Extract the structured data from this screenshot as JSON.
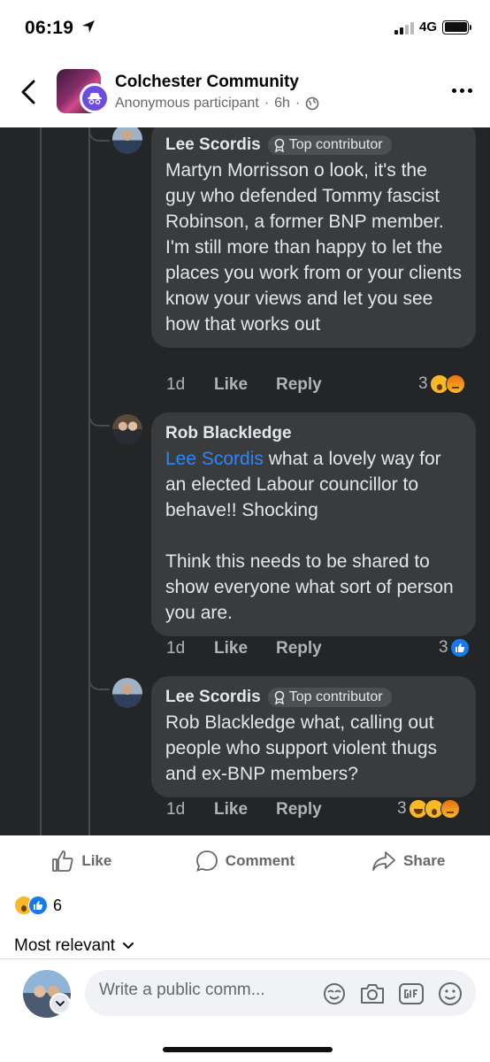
{
  "status_bar": {
    "time": "06:19",
    "network": "4G"
  },
  "header": {
    "group_name": "Colchester Community",
    "participant": "Anonymous participant",
    "age": "6h",
    "separator": "·"
  },
  "comments": [
    {
      "author": "Lee Scordis",
      "badge": "Top contributor",
      "mention": "",
      "text": "Martyn Morrisson o look, it's the guy who defended Tommy fascist Robinson, a former BNP member. I'm still more than happy to let the places you work from or your clients know your views and let you see how that works out",
      "time": "1d",
      "like": "Like",
      "reply": "Reply",
      "reactions": "3",
      "reaction_icons": [
        "wow-emoji-icon",
        "angry-emoji-icon"
      ]
    },
    {
      "author": "Rob Blackledge",
      "badge": "",
      "mention": "Lee Scordis",
      "text": " what a lovely way for an elected Labour councillor to behave!! Shocking\n\nThink this needs to be shared to show everyone what sort of person you are.",
      "time": "1d",
      "like": "Like",
      "reply": "Reply",
      "reactions": "3",
      "reaction_icons": [
        "like-reaction-icon"
      ]
    },
    {
      "author": "Lee Scordis",
      "badge": "Top contributor",
      "mention": "",
      "text": "Rob Blackledge what, calling out people who support violent thugs and ex-BNP members?",
      "time": "1d",
      "like": "Like",
      "reply": "Reply",
      "reactions": "3",
      "reaction_icons": [
        "haha-emoji-icon",
        "wow-emoji-icon",
        "angry-emoji-icon"
      ]
    }
  ],
  "actions": {
    "like": "Like",
    "comment": "Comment",
    "share": "Share"
  },
  "post_reactions": {
    "count": "6"
  },
  "sort": {
    "label": "Most relevant"
  },
  "composer": {
    "placeholder": "Write a public comm..."
  },
  "colors": {
    "dark_bg": "#242526",
    "bubble": "#3a3b3c",
    "mention": "#2d86ff",
    "accent": "#1877f2"
  }
}
